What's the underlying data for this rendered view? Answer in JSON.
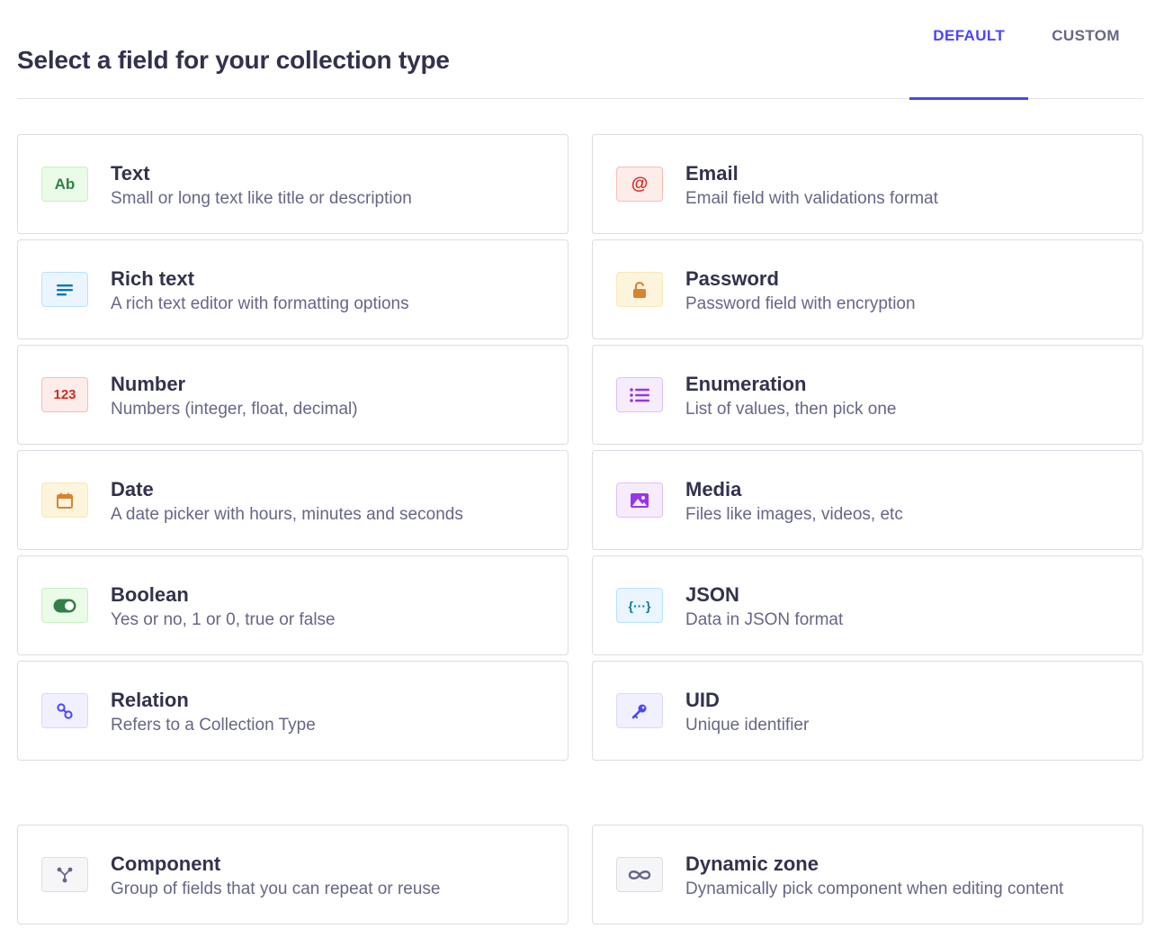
{
  "header": {
    "title": "Select a field for your collection type",
    "tabs": [
      {
        "label": "DEFAULT",
        "active": true
      },
      {
        "label": "CUSTOM",
        "active": false
      }
    ]
  },
  "fields": [
    {
      "label": "Text",
      "description": "Small or long text like title or description",
      "icon": "text-icon",
      "icon_text": "Ab"
    },
    {
      "label": "Email",
      "description": "Email field with validations format",
      "icon": "email-icon",
      "icon_text": "@"
    },
    {
      "label": "Rich text",
      "description": "A rich text editor with formatting options",
      "icon": "rich-text-icon"
    },
    {
      "label": "Password",
      "description": "Password field with encryption",
      "icon": "lock-icon"
    },
    {
      "label": "Number",
      "description": "Numbers (integer, float, decimal)",
      "icon": "number-icon",
      "icon_text": "123"
    },
    {
      "label": "Enumeration",
      "description": "List of values, then pick one",
      "icon": "list-icon"
    },
    {
      "label": "Date",
      "description": "A date picker with hours, minutes and seconds",
      "icon": "calendar-icon"
    },
    {
      "label": "Media",
      "description": "Files like images, videos, etc",
      "icon": "image-icon"
    },
    {
      "label": "Boolean",
      "description": "Yes or no, 1 or 0, true or false",
      "icon": "toggle-icon"
    },
    {
      "label": "JSON",
      "description": "Data in JSON format",
      "icon": "json-icon",
      "icon_text": "{···}"
    },
    {
      "label": "Relation",
      "description": "Refers to a Collection Type",
      "icon": "relation-icon"
    },
    {
      "label": "UID",
      "description": "Unique identifier",
      "icon": "key-icon"
    }
  ],
  "extra_fields": [
    {
      "label": "Component",
      "description": "Group of fields that you can repeat or reuse",
      "icon": "component-icon"
    },
    {
      "label": "Dynamic zone",
      "description": "Dynamically pick component when editing content",
      "icon": "infinity-icon"
    }
  ],
  "colors": {
    "accent": "#4945ff",
    "text_primary": "#32324d",
    "text_secondary": "#666687"
  }
}
